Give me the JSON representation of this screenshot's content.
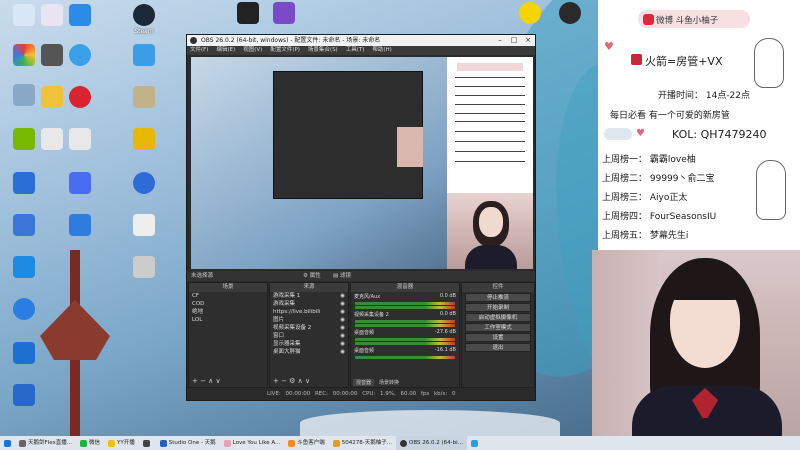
{
  "desktop": {
    "icons_col1": [
      "",
      "",
      "",
      "",
      "",
      "",
      "",
      "",
      "",
      "",
      "",
      "",
      ""
    ],
    "icons_col2": [
      "",
      "",
      "",
      "",
      ""
    ],
    "icons_col3": [
      "",
      "",
      "",
      "",
      "",
      "",
      ""
    ],
    "icons_col4": [
      "Steam",
      "",
      "",
      "",
      "",
      "",
      ""
    ]
  },
  "obs": {
    "title": "OBS 26.0.2 (64-bit, windows) - 配置文件: 未命名 - 场景: 未命名",
    "menu": [
      "文件(F)",
      "编辑(E)",
      "视图(V)",
      "配置文件(P)",
      "场景集合(S)",
      "工具(T)",
      "帮助(H)"
    ],
    "source_label": "未选择源",
    "properties_label": "属性",
    "filters_label": "滤镜",
    "scenes_header": "场景",
    "scenes": [
      "CF",
      "COD",
      "绝地",
      "LOL"
    ],
    "sources_header": "来源",
    "sources": [
      "游戏采集 1",
      "游戏采集",
      "https://live.bilibili",
      "图片",
      "视频采集设备 2",
      "窗口",
      "显示器采集",
      "桌面大胖猫"
    ],
    "mixer_header": "混音器",
    "mixer_tracks": [
      {
        "name": "麦克风/Aux",
        "db": "0.0 dB"
      },
      {
        "name": "视频采集设备 2",
        "db": "0.0 dB"
      },
      {
        "name": "桌面音频",
        "db": "-27.6 dB"
      },
      {
        "name": "桌面音频",
        "db": "-16.1 dB"
      }
    ],
    "mixer_tabs": [
      "混音器",
      "场景转换"
    ],
    "controls_header": "控件",
    "controls": [
      "停止推流",
      "开始录制",
      "启动虚拟摄像机",
      "工作室模式",
      "设置",
      "退出"
    ],
    "status": {
      "live": "LIVE: 00:00:00",
      "rec": "REC: 00:00:00",
      "cpu": "CPU: 1.9%, 60.00 fps",
      "kbps": "kb/s: 0"
    }
  },
  "profile": {
    "brand": "微博  斗鱼小柚子",
    "line1": "火箭=房管+VX",
    "line2": "开播时间：  14点-22点",
    "line3": "每日必看  有一个可爱的新房管",
    "kol": "KOL: QH7479240",
    "weeks": [
      "上周榜一：  霸霸love柚",
      "上周榜二：  99999丶俞二宝",
      "上周榜三：  Aiyo正太",
      "上周榜四：  FourSeasonsIU",
      "上周榜五：  梦幕先生i"
    ]
  },
  "taskbar": {
    "items": [
      "天鹅剑Flex直播...",
      "微信",
      "YY开播",
      "",
      "Studio One - 天鹅",
      "Love You Like A...",
      "斗鱼客户端",
      "504278-天鹅柚子...",
      "OBS 26.0.2 (64-bi...",
      ""
    ]
  },
  "colors": {
    "accent": "#e0283c",
    "obs_bg": "#2b2b2b"
  }
}
